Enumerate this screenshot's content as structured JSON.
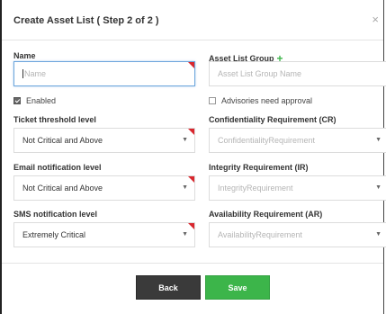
{
  "dialog": {
    "title": "Create Asset List ( Step 2 of 2 )",
    "close_glyph": "×"
  },
  "form": {
    "name": {
      "label": "Name",
      "placeholder": "Name",
      "value": ""
    },
    "asset_list_group": {
      "label": "Asset List Group",
      "add_glyph": "+",
      "placeholder": "Asset List Group Name"
    },
    "enabled": {
      "label": "Enabled",
      "checked": true
    },
    "advisories": {
      "label": "Advisories need approval",
      "checked": false
    },
    "ticket_threshold": {
      "label": "Ticket threshold level",
      "value": "Not Critical and Above"
    },
    "confidentiality": {
      "label": "Confidentiality Requirement (CR)",
      "placeholder": "ConfidentialityRequirement"
    },
    "email_notification": {
      "label": "Email notification level",
      "value": "Not Critical and Above"
    },
    "integrity": {
      "label": "Integrity Requirement (IR)",
      "placeholder": "IntegrityRequirement"
    },
    "sms_notification": {
      "label": "SMS notification level",
      "value": "Extremely Critical"
    },
    "availability": {
      "label": "Availability Requirement (AR)",
      "placeholder": "AvailabilityRequirement"
    }
  },
  "footer": {
    "back_label": "Back",
    "save_label": "Save"
  },
  "colors": {
    "save": "#3cb54a",
    "back": "#3a3a3a",
    "required_marker": "#d9272e",
    "focus_border": "#6ea6dd"
  },
  "icons": {
    "dropdown": "chevron-down-icon",
    "close": "close-icon",
    "add": "plus-icon"
  }
}
